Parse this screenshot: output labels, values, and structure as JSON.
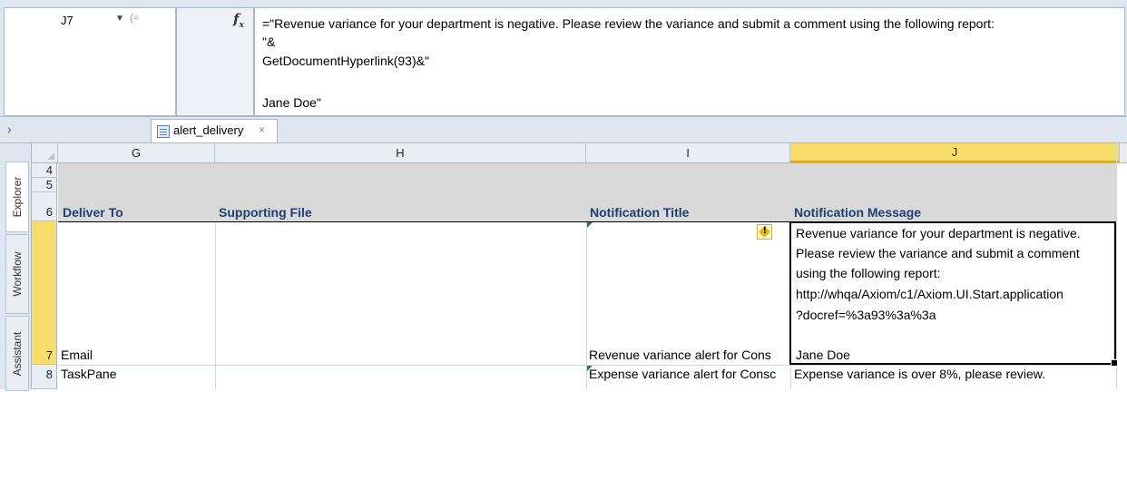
{
  "formula_bar": {
    "name_box": "J7",
    "fx_symbol": "fx",
    "formula_lines": [
      "=\"Revenue variance for your department is negative. Please review the variance and submit a comment using the following report:",
      "\"&",
      "GetDocumentHyperlink(93)&\"",
      "",
      "Jane Doe\""
    ]
  },
  "tab_bar": {
    "collapse_glyph": "›",
    "tab_label": "alert_delivery",
    "close_glyph": "×"
  },
  "side_panel": {
    "tabs": [
      "Explorer",
      "Workflow",
      "Assistant"
    ]
  },
  "columns": [
    "G",
    "H",
    "I",
    "J"
  ],
  "rows": [
    "4",
    "5",
    "6",
    "7",
    "8"
  ],
  "header_row": {
    "deliver_to": "Deliver To",
    "supporting_file": "Supporting File",
    "notification_title": "Notification Title",
    "notification_message": "Notification Message"
  },
  "data_rows": [
    {
      "row": "7",
      "deliver_to": "Email",
      "supporting_file": "",
      "notification_title": "Revenue variance alert for Cons",
      "notification_message_lines": [
        "Revenue variance for your department is negative.",
        "Please review the variance and submit a comment",
        "using the following report:",
        "http://whqa/Axiom/c1/Axiom.UI.Start.application",
        "?docref=%3a93%3a%3a",
        "",
        "Jane Doe"
      ]
    },
    {
      "row": "8",
      "deliver_to": "TaskPane",
      "supporting_file": "",
      "notification_title": "Expense variance alert for Consc",
      "notification_message": "Expense variance is over 8%, please review."
    }
  ],
  "colors": {
    "chrome_bg": "#dfe6ef",
    "header_text": "#1f3f6f",
    "selected_header": "#f8dd6b",
    "band_gray": "#d9d9d9",
    "comment_indicator": "#1a8a1a"
  },
  "icons": {
    "cell_warning": "warning-diamond-icon",
    "tab_document": "sheet-document-icon"
  }
}
